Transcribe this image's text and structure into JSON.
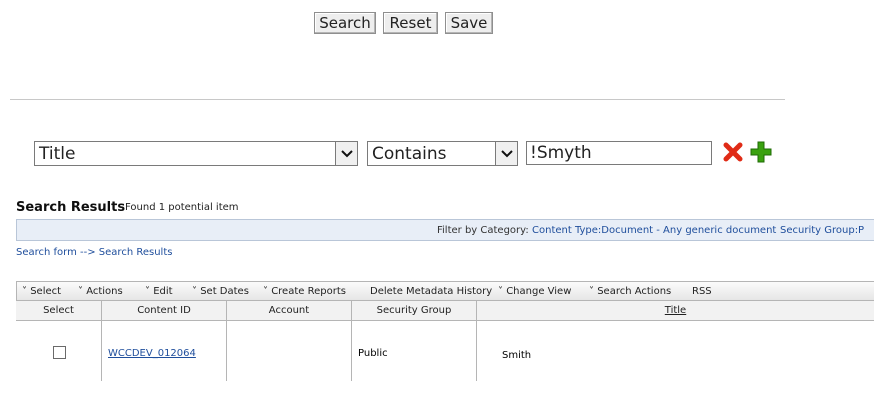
{
  "buttons": {
    "search": "Search",
    "reset": "Reset",
    "save": "Save"
  },
  "criteria": {
    "field": "Title",
    "operator": "Contains",
    "value": "!Smyth"
  },
  "results": {
    "title": "Search Results",
    "found": "Found 1 potential item",
    "filter_label": "Filter by Category:",
    "filter_content_type": "Content Type:Document - Any generic document",
    "filter_security_group": "Security Group:P",
    "breadcrumb": "Search form --> Search Results"
  },
  "toolbar": {
    "select": "Select",
    "actions": "Actions",
    "edit": "Edit",
    "set_dates": "Set Dates",
    "create_reports": "Create Reports",
    "delete_metadata_history": "Delete Metadata History",
    "change_view": "Change View",
    "search_actions": "Search Actions",
    "rss": "RSS"
  },
  "table": {
    "headers": [
      "Select",
      "Content ID",
      "Account",
      "Security Group",
      "Title"
    ],
    "rows": [
      {
        "content_id": "WCCDEV_012064",
        "account": "",
        "security_group": "Public",
        "title": "Smith"
      }
    ]
  },
  "colors": {
    "link": "#1f4e9c",
    "remove_icon": "#e02b16",
    "add_icon": "#3aa10f"
  }
}
